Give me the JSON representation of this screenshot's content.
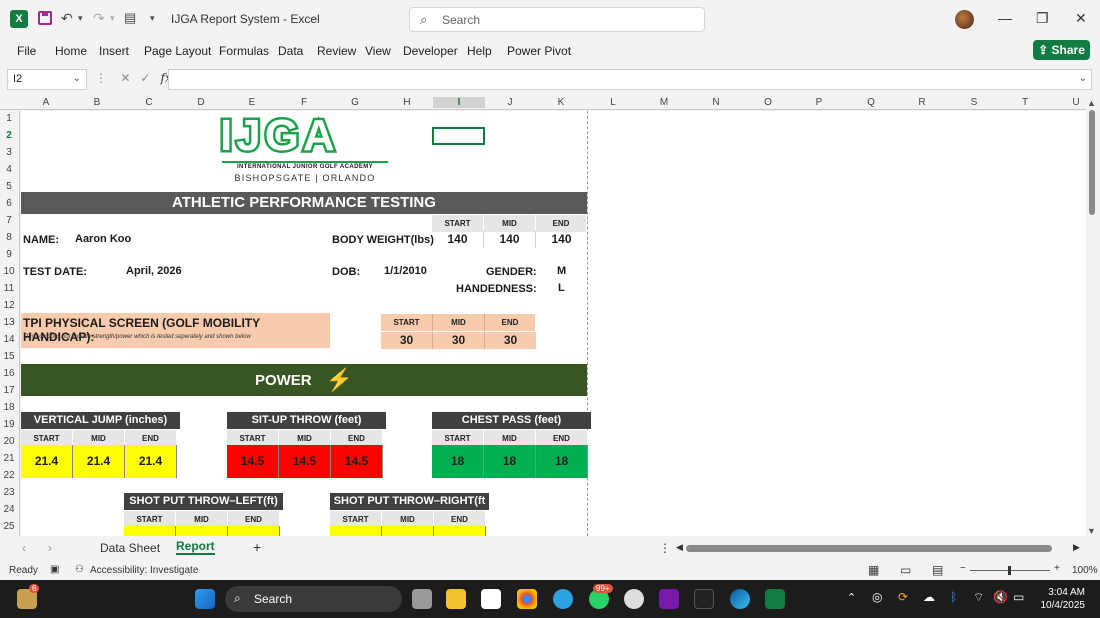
{
  "window": {
    "title": "IJGA Report System  -  Excel",
    "search_placeholder": "Search"
  },
  "menu": [
    "File",
    "Home",
    "Insert",
    "Page Layout",
    "Formulas",
    "Data",
    "Review",
    "View",
    "Developer",
    "Help",
    "Power Pivot"
  ],
  "share_label": "Share",
  "formula_bar": {
    "name_box": "I2",
    "fx": "fx",
    "formula": ""
  },
  "columns": [
    "A",
    "B",
    "C",
    "D",
    "E",
    "F",
    "G",
    "H",
    "I",
    "J",
    "K",
    "L",
    "M",
    "N",
    "O",
    "P",
    "Q",
    "R",
    "S",
    "T",
    "U"
  ],
  "rows": [
    "1",
    "2",
    "3",
    "4",
    "5",
    "6",
    "7",
    "8",
    "9",
    "10",
    "11",
    "12",
    "13",
    "14",
    "15",
    "16",
    "17",
    "18",
    "19",
    "20",
    "21",
    "22",
    "23",
    "24",
    "25"
  ],
  "sheet": {
    "logo": {
      "name": "IJGA",
      "subtitle": "INTERNATIONAL JUNIOR GOLF ACADEMY",
      "location": "BISHOPSGATE | ORLANDO"
    },
    "banner": "ATHLETIC PERFORMANCE TESTING",
    "name_label": "NAME:",
    "name_value": "Aaron Koo",
    "bw_label": "BODY WEIGHT(lbs)",
    "phase_headers": [
      "START",
      "MID",
      "END"
    ],
    "bw_values": [
      "140",
      "140",
      "140"
    ],
    "test_date_label": "TEST DATE:",
    "test_date_value": "April, 2026",
    "dob_label": "DOB:",
    "dob_value": "1/1/2010",
    "gender_label": "GENDER:",
    "gender_value": "M",
    "hand_label": "HANDEDNESS:",
    "hand_value": "L",
    "tpi_title": "TPI PHYSICAL SCREEN (GOLF MOBILITY HANDICAP):",
    "tpi_note": "This hcp does not include strength/power which is tested seperately and shown below",
    "tpi_values": [
      "30",
      "30",
      "30"
    ],
    "power_title": "POWER",
    "power_icon": "lightning-bolt-icon",
    "tests": [
      {
        "title": "VERTICAL JUMP (inches)",
        "values": [
          "21.4",
          "21.4",
          "21.4"
        ],
        "color": "#ffff00"
      },
      {
        "title": "SIT-UP THROW (feet)",
        "values": [
          "14.5",
          "14.5",
          "14.5"
        ],
        "color": "#ff0000"
      },
      {
        "title": "CHEST PASS (feet)",
        "values": [
          "18",
          "18",
          "18"
        ],
        "color": "#00b050"
      },
      {
        "title": "SHOT PUT THROW–LEFT(ft)",
        "values": [
          "",
          "",
          ""
        ],
        "color": "#ffff00"
      },
      {
        "title": "SHOT PUT THROW–RIGHT(ft",
        "values": [
          "",
          "",
          ""
        ],
        "color": "#ffff00"
      }
    ]
  },
  "tabs": [
    "Data Sheet",
    "Report"
  ],
  "status": {
    "ready": "Ready",
    "accessibility": "Accessibility: Investigate",
    "zoom": "100%"
  },
  "taskbar": {
    "search": "Search",
    "time": "3:04 AM",
    "date": "10/4/2025",
    "badge_count": "99+",
    "widget_badge": "6"
  }
}
